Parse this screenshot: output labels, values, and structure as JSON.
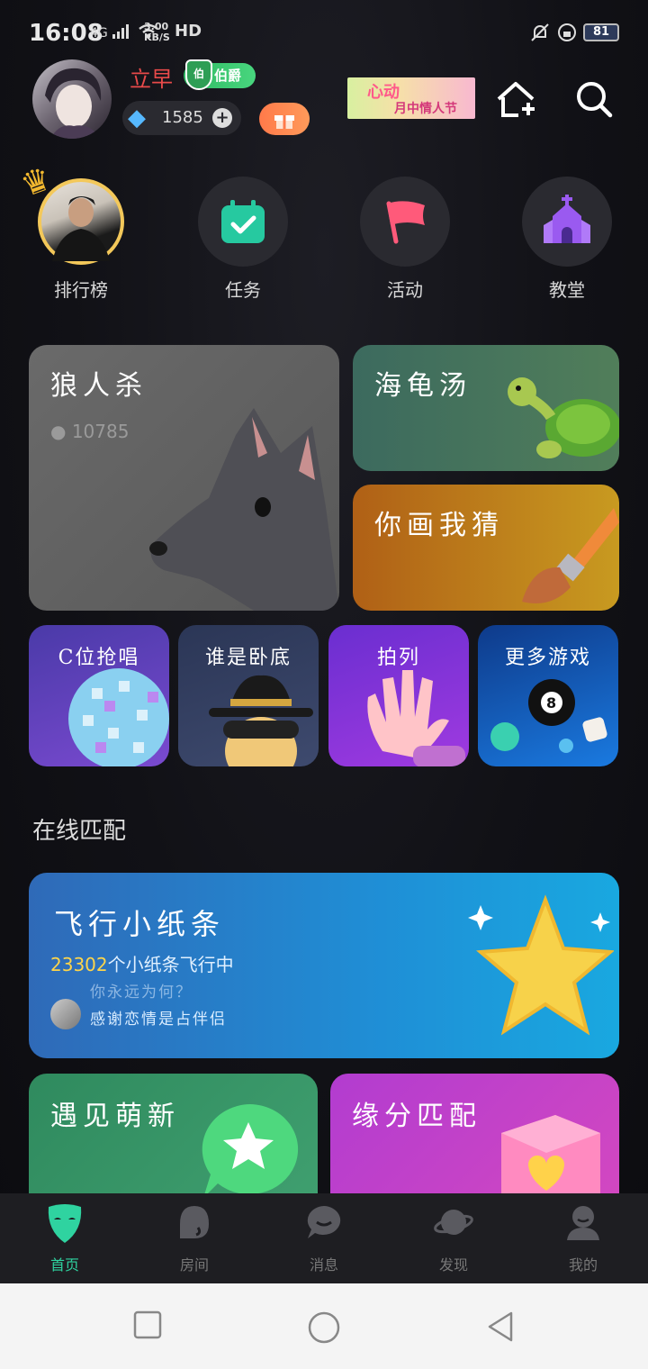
{
  "status_bar": {
    "time": "16:08",
    "signal": "4G",
    "speed_value": "3.00",
    "speed_unit": "KB/S",
    "hd": "HD",
    "battery": "81"
  },
  "header": {
    "username": "立早",
    "badge_level": "伯爵",
    "badge_icon_text": "伯",
    "diamonds": "1585",
    "banner_title": "心动",
    "banner_subtitle": "月中情人节"
  },
  "quick_menu": [
    {
      "label": "排行榜",
      "icon": "crown-avatar-icon"
    },
    {
      "label": "任务",
      "icon": "calendar-check-icon"
    },
    {
      "label": "活动",
      "icon": "flag-icon"
    },
    {
      "label": "教堂",
      "icon": "church-icon"
    }
  ],
  "games": {
    "werewolf": {
      "title": "狼人杀",
      "players": "10785"
    },
    "turtle": {
      "title": "海龟汤"
    },
    "draw": {
      "title": "你画我猜"
    },
    "small": [
      {
        "title": "C位抢唱",
        "icon": "disco-ball-icon"
      },
      {
        "title": "谁是卧底",
        "icon": "spy-icon"
      },
      {
        "title": "拍列",
        "icon": "wave-hand-icon"
      },
      {
        "title": "更多游戏",
        "icon": "billiard-ball-icon"
      }
    ]
  },
  "online_match": {
    "section_title": "在线匹配",
    "plane": {
      "title": "飞行小纸条",
      "count": "23302",
      "count_suffix": "个小纸条飞行中",
      "message_faded": "你永远为何？",
      "message": "感谢恋情是占伴侣"
    },
    "meet": {
      "title": "遇见萌新"
    },
    "fate": {
      "title": "缘分匹配"
    }
  },
  "tabs": [
    {
      "label": "首页",
      "active": true
    },
    {
      "label": "房间",
      "active": false
    },
    {
      "label": "消息",
      "active": false
    },
    {
      "label": "发现",
      "active": false
    },
    {
      "label": "我的",
      "active": false
    }
  ],
  "colors": {
    "accent": "#2fd3a0",
    "background": "#111116",
    "username": "#e84a4a"
  }
}
